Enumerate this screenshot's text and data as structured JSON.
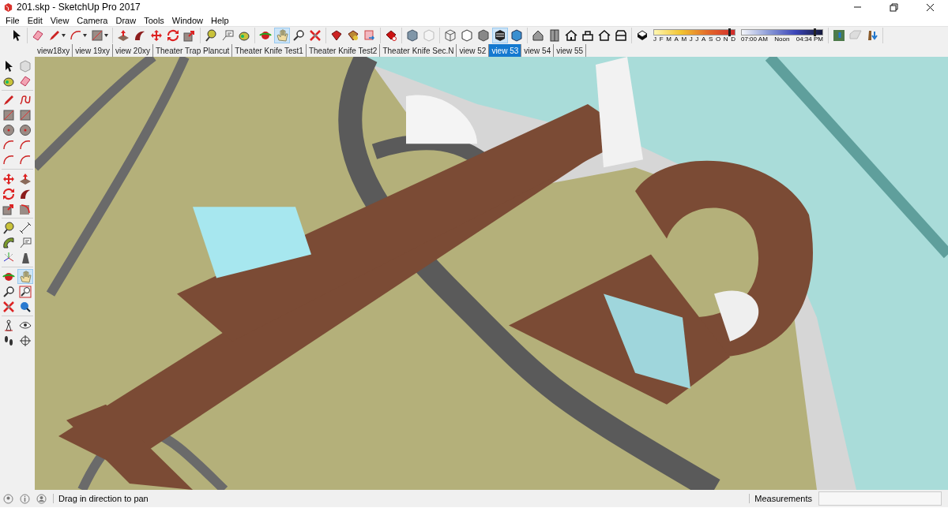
{
  "window": {
    "title": "201.skp - SketchUp Pro 2017"
  },
  "menu": [
    "File",
    "Edit",
    "View",
    "Camera",
    "Draw",
    "Tools",
    "Window",
    "Help"
  ],
  "main_toolbar": [
    {
      "selected": false
    },
    {
      "selected": false
    },
    {
      "selected": false
    },
    {
      "selected": false
    },
    {
      "selected": false
    },
    {
      "selected": false
    },
    {
      "selected": false
    },
    {
      "selected": false
    },
    {
      "selected": false
    },
    {
      "selected": false
    },
    {
      "selected": false
    },
    {
      "selected": false
    },
    {
      "selected": false
    },
    {
      "selected": false
    },
    {
      "selected": true
    },
    {
      "selected": false
    },
    {
      "selected": false
    },
    {
      "selected": false
    },
    {
      "selected": false
    },
    {
      "selected": false
    },
    {
      "selected": false
    },
    {
      "selected": false
    },
    {
      "selected": false
    },
    {
      "selected": false
    },
    {
      "selected": false
    },
    {
      "selected": false
    },
    {
      "selected": true
    },
    {
      "selected": false
    },
    {
      "selected": false
    },
    {
      "selected": false
    },
    {
      "selected": false
    },
    {
      "selected": false
    },
    {
      "selected": false
    },
    {
      "selected": false
    },
    {
      "selected": false
    },
    {
      "selected": false
    },
    {
      "selected": false
    },
    {
      "selected": false
    }
  ],
  "date_slider": {
    "level": 0.93,
    "months": [
      "J",
      "F",
      "M",
      "A",
      "M",
      "J",
      "J",
      "A",
      "S",
      "O",
      "N",
      "D"
    ]
  },
  "time_slider": {
    "level": 0.9,
    "labels": [
      "07:00 AM",
      "Noon",
      "04:34 PM"
    ]
  },
  "scene_tabs": [
    {
      "label": "view18xy",
      "selected": false
    },
    {
      "label": "view 19xy",
      "selected": false
    },
    {
      "label": "view 20xy",
      "selected": false
    },
    {
      "label": "Theater Trap Plancut",
      "selected": false
    },
    {
      "label": "Theater Knife Test1",
      "selected": false
    },
    {
      "label": "Theater Knife Test2",
      "selected": false
    },
    {
      "label": "Theater Knife Sec.N",
      "selected": false
    },
    {
      "label": "view 52",
      "selected": false
    },
    {
      "label": "view 53",
      "selected": true
    },
    {
      "label": "view 54",
      "selected": false
    },
    {
      "label": "view 55",
      "selected": false
    }
  ],
  "left_toolbar": [
    {
      "selected": false
    },
    {
      "selected": false
    },
    {
      "selected": false
    },
    {
      "selected": false
    },
    {
      "selected": false
    },
    {
      "selected": false
    },
    {
      "selected": false
    },
    {
      "selected": false
    },
    {
      "selected": false
    },
    {
      "selected": false
    },
    {
      "selected": false
    },
    {
      "selected": false
    },
    {
      "selected": false
    },
    {
      "selected": false
    },
    {
      "selected": false
    },
    {
      "selected": false
    },
    {
      "selected": false
    },
    {
      "selected": false
    },
    {
      "selected": false
    },
    {
      "selected": false
    },
    {
      "selected": false
    },
    {
      "selected": false
    },
    {
      "selected": false
    },
    {
      "selected": false
    },
    {
      "selected": false
    },
    {
      "selected": false
    },
    {
      "selected": false
    },
    {
      "selected": true
    },
    {
      "selected": false
    },
    {
      "selected": false
    },
    {
      "selected": false
    },
    {
      "selected": false
    },
    {
      "selected": false
    },
    {
      "selected": false
    },
    {
      "selected": false
    },
    {
      "selected": false
    }
  ],
  "status_bar": {
    "hint": "Drag in direction to pan",
    "measurements_label": "Measurements"
  }
}
